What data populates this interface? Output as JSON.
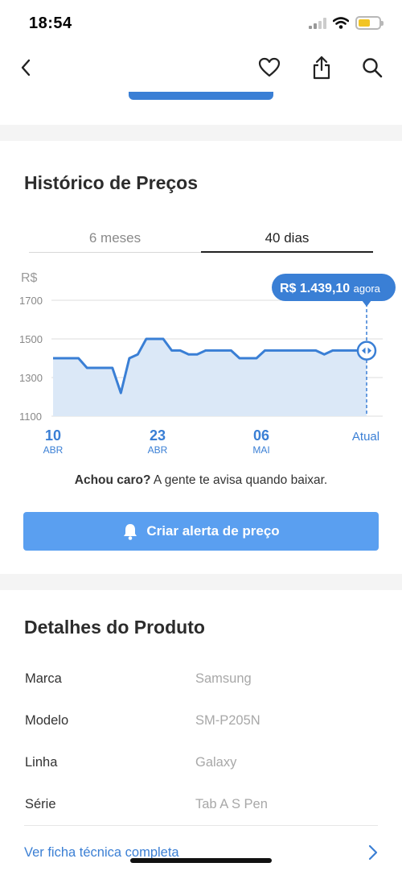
{
  "status_bar": {
    "time": "18:54"
  },
  "nav": {
    "back": "back",
    "favorite": "heart",
    "share": "share",
    "search": "search"
  },
  "price_history": {
    "title": "Histórico de Preços",
    "tabs": [
      {
        "label": "6 meses",
        "active": false
      },
      {
        "label": "40 dias",
        "active": true
      }
    ],
    "tooltip": {
      "price": "R$ 1.439,10",
      "suffix": "agora"
    },
    "note_bold": "Achou caro?",
    "note_rest": " A gente te avisa quando baixar.",
    "alert_button": "Criar alerta de preço"
  },
  "chart_data": {
    "type": "area",
    "ylabel": "R$",
    "ylim": [
      1100,
      1700
    ],
    "yticks": [
      "1700",
      "1500",
      "1300",
      "1100"
    ],
    "x_labels": [
      {
        "day": "10",
        "month": "ABR"
      },
      {
        "day": "23",
        "month": "ABR"
      },
      {
        "day": "06",
        "month": "MAI"
      },
      {
        "day": "Atual",
        "month": ""
      }
    ],
    "values": [
      1400,
      1400,
      1400,
      1400,
      1350,
      1350,
      1350,
      1350,
      1220,
      1400,
      1420,
      1500,
      1500,
      1500,
      1440,
      1440,
      1420,
      1420,
      1440,
      1440,
      1440,
      1440,
      1400,
      1400,
      1400,
      1440,
      1440,
      1440,
      1440,
      1440,
      1440,
      1440,
      1420,
      1440,
      1440,
      1440,
      1440,
      1439.1
    ],
    "grid": true,
    "colors": {
      "line": "#3a7fd5",
      "fill": "#dbe8f7",
      "tooltip": "#3a7fd5"
    }
  },
  "product_details": {
    "title": "Detalhes do Produto",
    "rows": [
      {
        "label": "Marca",
        "value": "Samsung"
      },
      {
        "label": "Modelo",
        "value": "SM-P205N"
      },
      {
        "label": "Linha",
        "value": "Galaxy"
      },
      {
        "label": "Série",
        "value": "Tab A S Pen"
      }
    ],
    "full_link": "Ver ficha técnica completa"
  }
}
